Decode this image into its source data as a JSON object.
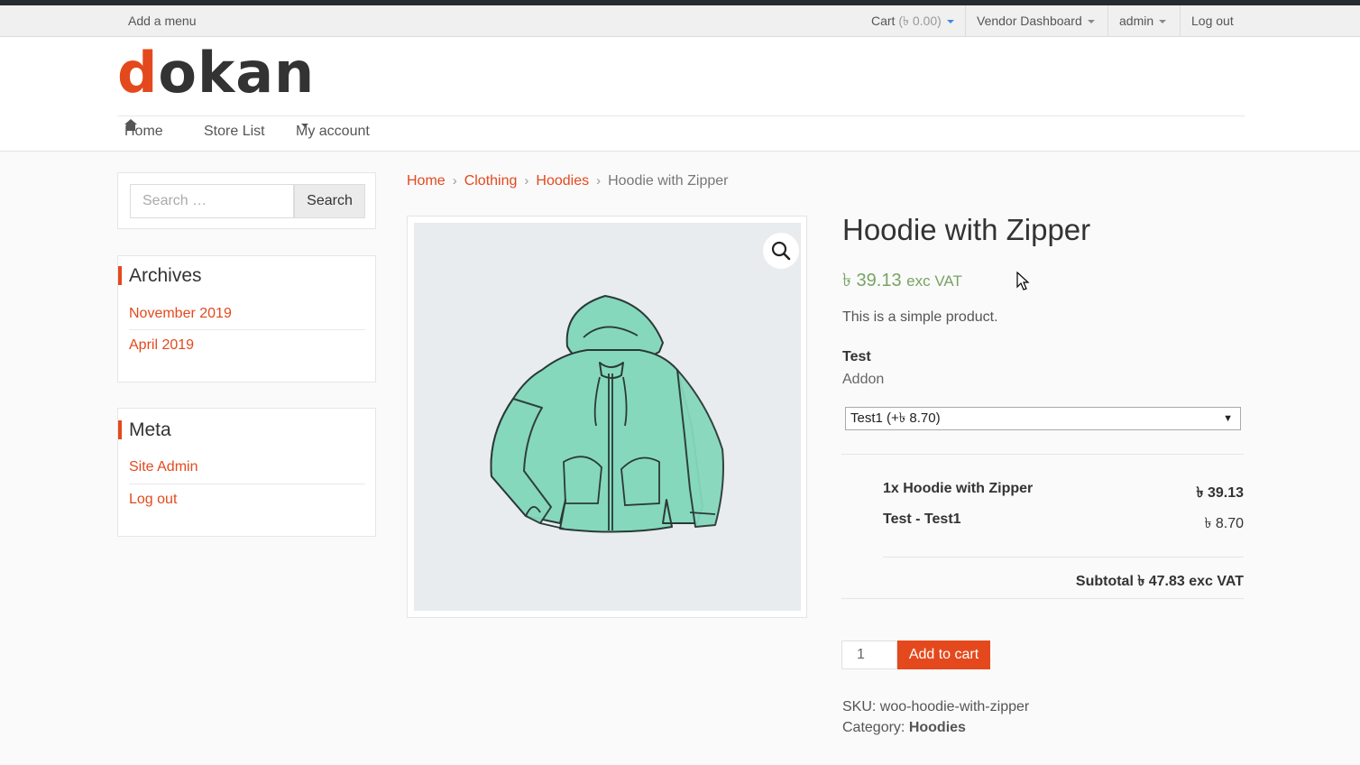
{
  "topbar": {
    "add_menu": "Add a menu",
    "cart_label": "Cart",
    "cart_amount": "(৳ 0.00)",
    "vendor_dashboard": "Vendor Dashboard",
    "admin": "admin",
    "logout": "Log out"
  },
  "logo": {
    "first_letter": "d",
    "rest": "okan"
  },
  "nav": {
    "home": "Home",
    "store_list": "Store List",
    "my_account": "My account"
  },
  "sidebar": {
    "search": {
      "placeholder": "Search …",
      "button": "Search"
    },
    "archives": {
      "title": "Archives",
      "items": [
        "November 2019",
        "April 2019"
      ]
    },
    "meta": {
      "title": "Meta",
      "items": [
        "Site Admin",
        "Log out"
      ]
    }
  },
  "breadcrumb": [
    "Home",
    "Clothing",
    "Hoodies",
    "Hoodie with Zipper"
  ],
  "breadcrumb_sep": "›",
  "product": {
    "title": "Hoodie with Zipper",
    "price": "৳ 39.13",
    "price_suffix": "exc VAT",
    "description": "This is a simple product.",
    "addon_label": "Test",
    "addon_sublabel": "Addon",
    "addon_selected": "Test1 (+৳ 8.70)",
    "summary": [
      {
        "label": "1x Hoodie with Zipper",
        "value": "৳ 39.13"
      },
      {
        "label": "Test - Test1",
        "value": "৳ 8.70"
      }
    ],
    "subtotal": "Subtotal ৳ 47.83 exc VAT",
    "quantity": "1",
    "add_to_cart": "Add to cart",
    "sku_label": "SKU:",
    "sku": "woo-hoodie-with-zipper",
    "category_label": "Category:",
    "category": "Hoodies"
  },
  "icons": {
    "home": "home-icon",
    "zoom": "magnifier-icon",
    "caret": "caret-down-icon",
    "cursor": "mouse-pointer-icon"
  },
  "colors": {
    "accent": "#e4491d",
    "price_green": "#77a464",
    "hoodie": "#86d8bd",
    "cart_caret": "#3b8ed8"
  }
}
